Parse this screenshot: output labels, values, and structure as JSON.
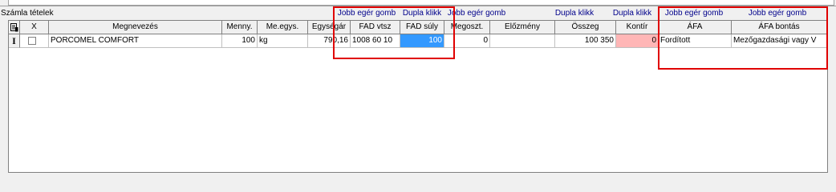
{
  "section": {
    "title": "Számla tételek"
  },
  "hints": {
    "jobb1": "Jobb egér gomb",
    "dupla1": "Dupla klikk",
    "jobb2": "Jobb egér gomb",
    "dupla2": "Dupla klikk",
    "dupla3": "Dupla klikk",
    "jobb3": "Jobb egér gomb",
    "jobb4": "Jobb egér gomb"
  },
  "columns": {
    "x": "X",
    "megnevezes": "Megnevezés",
    "menny": "Menny.",
    "meegys": "Me.egys.",
    "egysegar": "Egységár",
    "fadvtsz": "FAD vtsz",
    "fadsuly": "FAD súly",
    "megoszt": "Megoszt.",
    "elozmeny": "Előzmény",
    "osszeg": "Összeg",
    "kontir": "Kontír",
    "afa": "ÁFA",
    "afabontas": "ÁFA bontás"
  },
  "row": {
    "indicator": "I",
    "megnevezes": "PORCOMEL COMFORT",
    "menny": "100",
    "meegys": "kg",
    "egysegar": "790,16",
    "fadvtsz": "1008 60 10",
    "fadsuly": "100",
    "megoszt": "0",
    "elozmeny": "",
    "osszeg": "100 350",
    "kontir": "0",
    "afa": "Fordított",
    "afabontas": "Mezőgazdasági vagy V"
  },
  "colors": {
    "selection": "#3399ff",
    "highlight": "#ffb6b6",
    "hint_text": "#00008b",
    "annotation": "#e00000"
  }
}
